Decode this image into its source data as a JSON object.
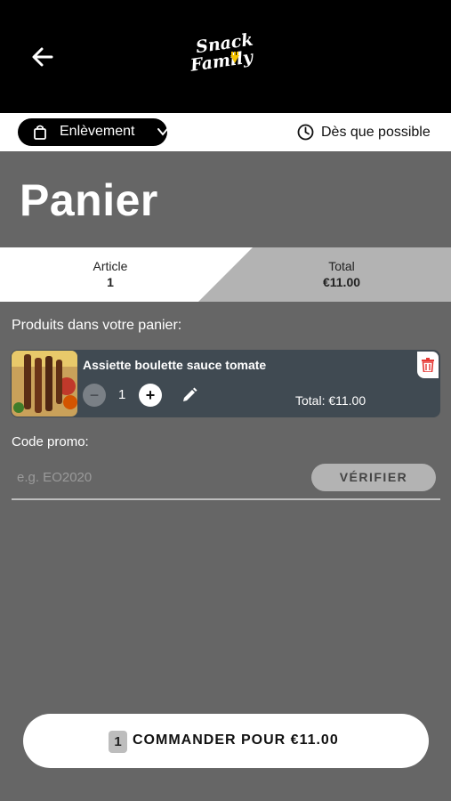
{
  "header": {
    "logo_line1": "Snack",
    "logo_line2": "Family"
  },
  "mode_bar": {
    "pickup_label": "Enlèvement",
    "schedule_label": "Dès que possible"
  },
  "page": {
    "title": "Panier"
  },
  "summary": {
    "article_label": "Article",
    "article_count": "1",
    "total_label": "Total",
    "total_value": "€11.00"
  },
  "cart": {
    "section_label": "Produits dans votre panier:",
    "items": [
      {
        "name": "Assiette boulette sauce tomate",
        "quantity": "1",
        "minus_label": "−",
        "plus_label": "+",
        "total": "Total: €11.00"
      }
    ]
  },
  "promo": {
    "label": "Code promo:",
    "placeholder": "e.g. EO2020",
    "verify_label": "VÉRIFIER"
  },
  "order": {
    "count": "1",
    "label": "COMMANDER POUR €11.00"
  },
  "colors": {
    "background": "#666666",
    "header": "#000000",
    "card": "#404a52",
    "delete_icon": "#e53935"
  },
  "icons": {
    "back": "arrow-left-icon",
    "pickup": "shopping-bag-icon",
    "dropdown": "chevron-down-icon",
    "schedule": "clock-icon",
    "edit": "pencil-icon",
    "delete": "trash-icon"
  }
}
